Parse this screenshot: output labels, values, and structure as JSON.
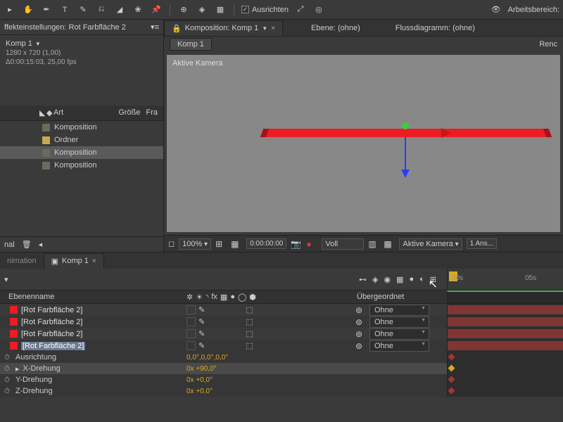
{
  "toolbar": {
    "align_label": "Ausrichten",
    "workspace_label": "Arbeitsbereich:"
  },
  "effect_panel": {
    "title": "ffekteinstellungen: Rot Farbfläche 2"
  },
  "comp": {
    "name": "Komp 1",
    "dims": "1280 x 720 (1,00)",
    "duration": "Δ0:00:15:03, 25,00 fps"
  },
  "project": {
    "head_label": "Art",
    "head_size": "Größe",
    "head_fr": "Fra",
    "items": [
      {
        "label": "Komposition",
        "type": "comp"
      },
      {
        "label": "Ordner",
        "type": "folder"
      },
      {
        "label": "Komposition",
        "type": "comp"
      },
      {
        "label": "Komposition",
        "type": "comp"
      }
    ],
    "footer_text": "nal"
  },
  "viewer_tabs": {
    "comp_prefix": "Komposition:",
    "comp_name": "Komp 1",
    "layer": "Ebene: (ohne)",
    "flow": "Flussdiagramm: (ohne)",
    "render": "Renc"
  },
  "sub_tab": "Komp 1",
  "canvas": {
    "camera": "Aktive Kamera"
  },
  "viewer_foot": {
    "zoom": "100%",
    "time": "0:00:00:00",
    "res": "Voll",
    "camera": "Aktive Kamera",
    "views": "1 Ans..."
  },
  "timeline": {
    "tab_left": "nimation",
    "tab_comp": "Komp 1",
    "ruler_00": "00s",
    "ruler_05": "05s",
    "head_name": "Ebenenname",
    "head_parent": "Übergeordnet",
    "layers": [
      {
        "name": "[Rot Farbfläche 2]",
        "parent": "Ohne"
      },
      {
        "name": "[Rot Farbfläche 2]",
        "parent": "Ohne"
      },
      {
        "name": "[Rot Farbfläche 2]",
        "parent": "Ohne"
      },
      {
        "name": "[Rot Farbfläche 2]",
        "parent": "Ohne"
      }
    ],
    "props": [
      {
        "label": "Ausrichtung",
        "value": "0,0°,0,0°,0,0°"
      },
      {
        "label": "X-Drehung",
        "value": "0x +90,0°"
      },
      {
        "label": "Y-Drehung",
        "value": "0x +0,0°"
      },
      {
        "label": "Z-Drehung",
        "value": "0x +0,0°"
      }
    ]
  }
}
